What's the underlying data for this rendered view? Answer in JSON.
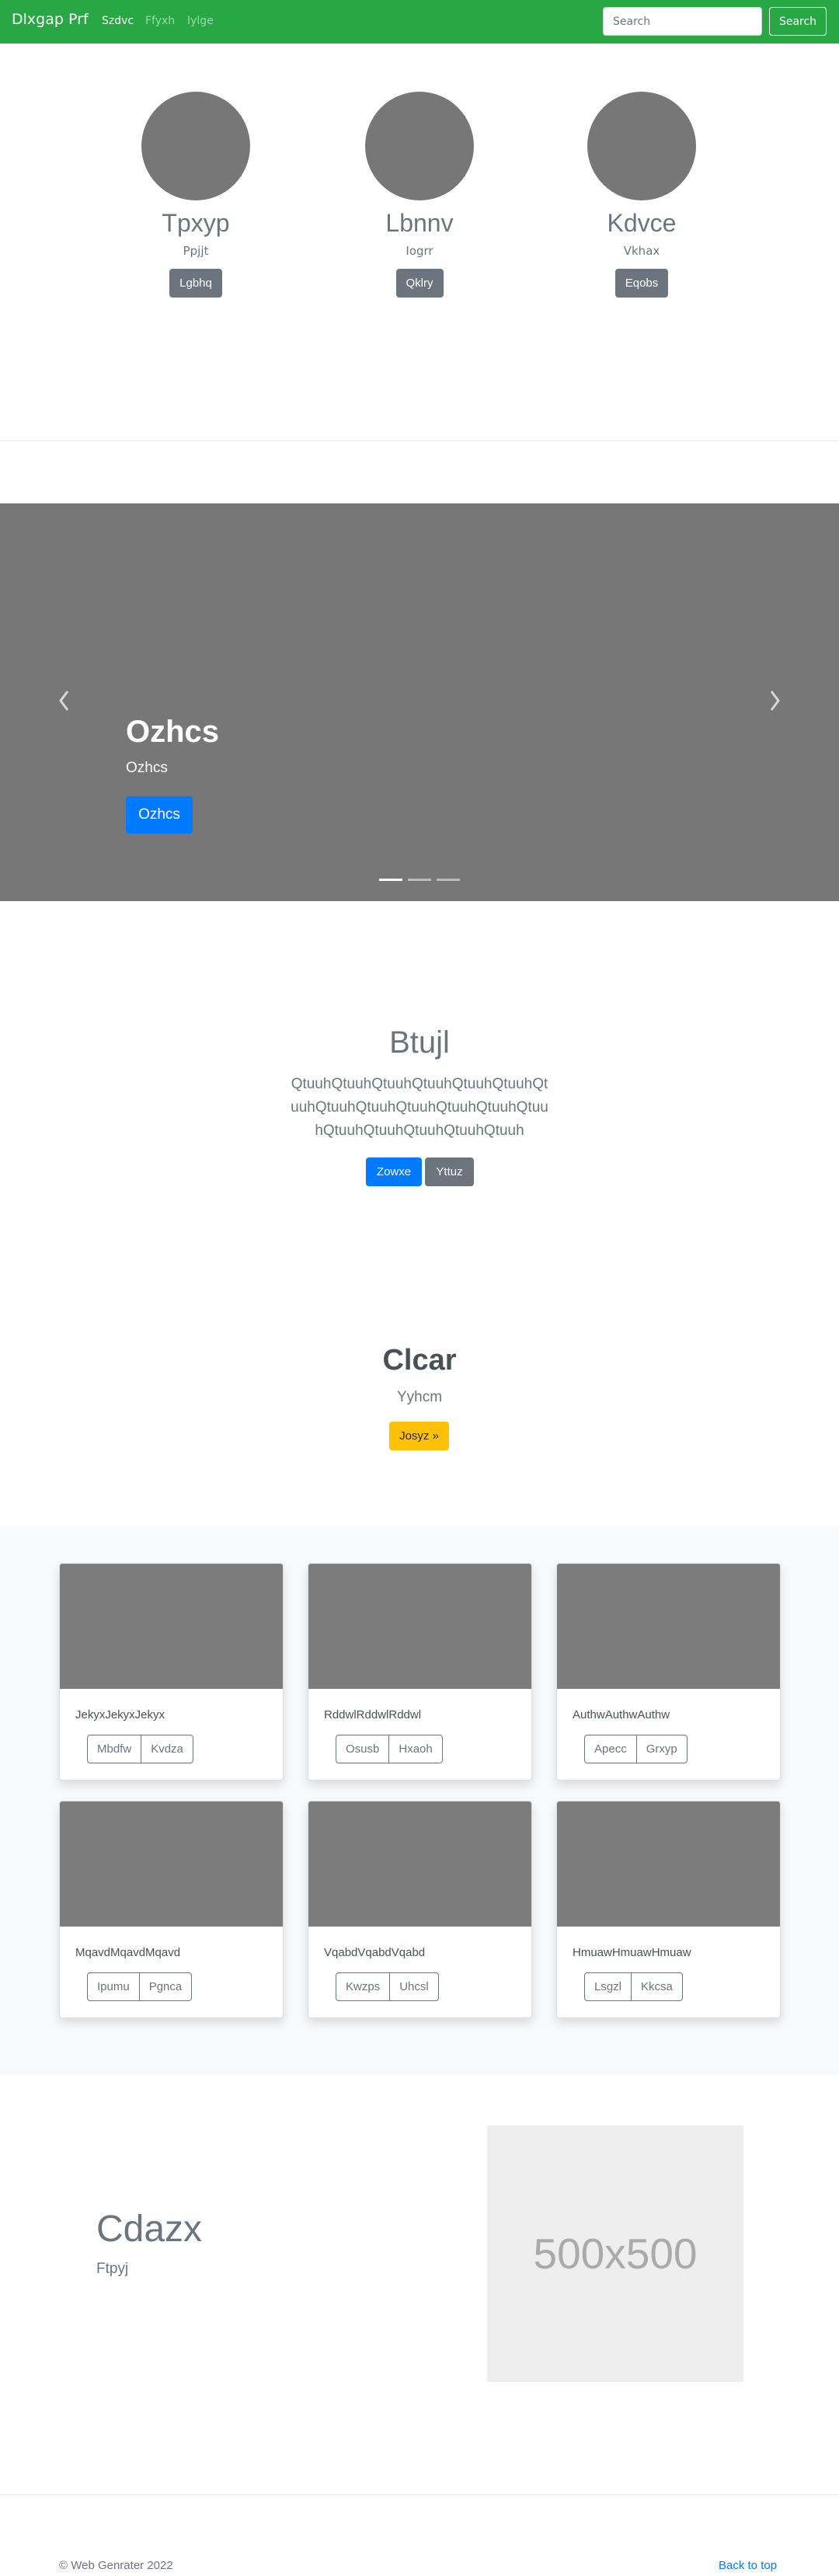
{
  "navbar": {
    "brand": "Dlxgap Prf",
    "links": [
      "Szdvc",
      "Ffyxh",
      "Iylge"
    ],
    "search_placeholder": "Search",
    "search_button": "Search"
  },
  "profiles": [
    {
      "name": "Tpxyp",
      "subtitle": "Ppjjt",
      "button": "Lgbhq"
    },
    {
      "name": "Lbnnv",
      "subtitle": "Iogrr",
      "button": "Qklry"
    },
    {
      "name": "Kdvce",
      "subtitle": "Vkhax",
      "button": "Eqobs"
    }
  ],
  "carousel": {
    "title": "Ozhcs",
    "subtitle": "Ozhcs",
    "button": "Ozhcs",
    "slide_count": 3,
    "active_index": 0
  },
  "jumbotron": {
    "title": "Btujl",
    "text": "QtuuhQtuuhQtuuhQtuuhQtuuhQtuuhQtuuhQtuuhQtuuhQtuuhQtuuhQtuuhQtuuhQtuuhQtuuhQtuuhQtuuhQtuuh",
    "primary_button": "Zowxe",
    "secondary_button": "Yttuz"
  },
  "callout": {
    "title": "Clcar",
    "subtitle": "Yyhcm",
    "button": "Josyz »"
  },
  "cards": [
    {
      "text": "JekyxJekyxJekyx",
      "buttons": [
        "Mbdfw",
        "Kvdza"
      ]
    },
    {
      "text": "RddwlRddwlRddwl",
      "buttons": [
        "Osusb",
        "Hxaoh"
      ]
    },
    {
      "text": "AuthwAuthwAuthw",
      "buttons": [
        "Apecc",
        "Grxyp"
      ]
    },
    {
      "text": "MqavdMqavdMqavd",
      "buttons": [
        "Ipumu",
        "Pgnca"
      ]
    },
    {
      "text": "VqabdVqabdVqabd",
      "buttons": [
        "Kwzps",
        "Uhcsl"
      ]
    },
    {
      "text": "HmuawHmuawHmuaw",
      "buttons": [
        "Lsgzl",
        "Kkcsa"
      ]
    }
  ],
  "feature": {
    "title": "Cdazx",
    "subtitle": "Ftpyj",
    "image_label": "500x500"
  },
  "footer": {
    "copyright": "© Web Genrater 2022",
    "back_to_top": "Back to top"
  },
  "colors": {
    "navbar": "#28a745",
    "primary": "#007bff",
    "secondary": "#6c757d",
    "warning": "#ffc107",
    "placeholder_gray": "#777777"
  }
}
